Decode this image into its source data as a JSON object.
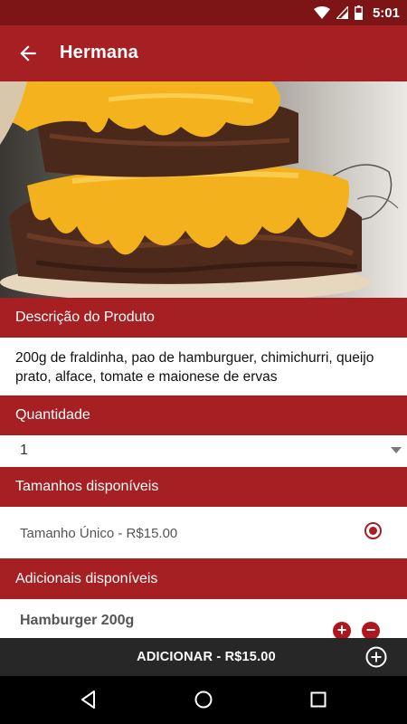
{
  "status_bar": {
    "time": "5:01",
    "icons": [
      "wifi-icon",
      "signal-icon",
      "battery-icon"
    ]
  },
  "app_bar": {
    "title": "Hermana",
    "back_icon": "arrow-back-icon"
  },
  "product": {
    "description_header": "Descrição do Produto",
    "description": "200g de fraldinha, pao de hamburguer, chimichurri, queijo prato, alface, tomate e maionese de ervas"
  },
  "quantity": {
    "header": "Quantidade",
    "value": "1"
  },
  "sizes": {
    "header": "Tamanhos disponíveis",
    "options": [
      {
        "label": "Tamanho Único - R$15.00",
        "selected": true
      }
    ]
  },
  "addons": {
    "header": "Adicionais disponíveis",
    "items": [
      {
        "name": "Hamburger 200g"
      }
    ]
  },
  "bottom_bar": {
    "add_label": "ADICIONAR - R$15.00"
  },
  "colors": {
    "primary": "#a51f23",
    "primary_dark": "#7d1416",
    "bottom_bar": "#272727"
  }
}
